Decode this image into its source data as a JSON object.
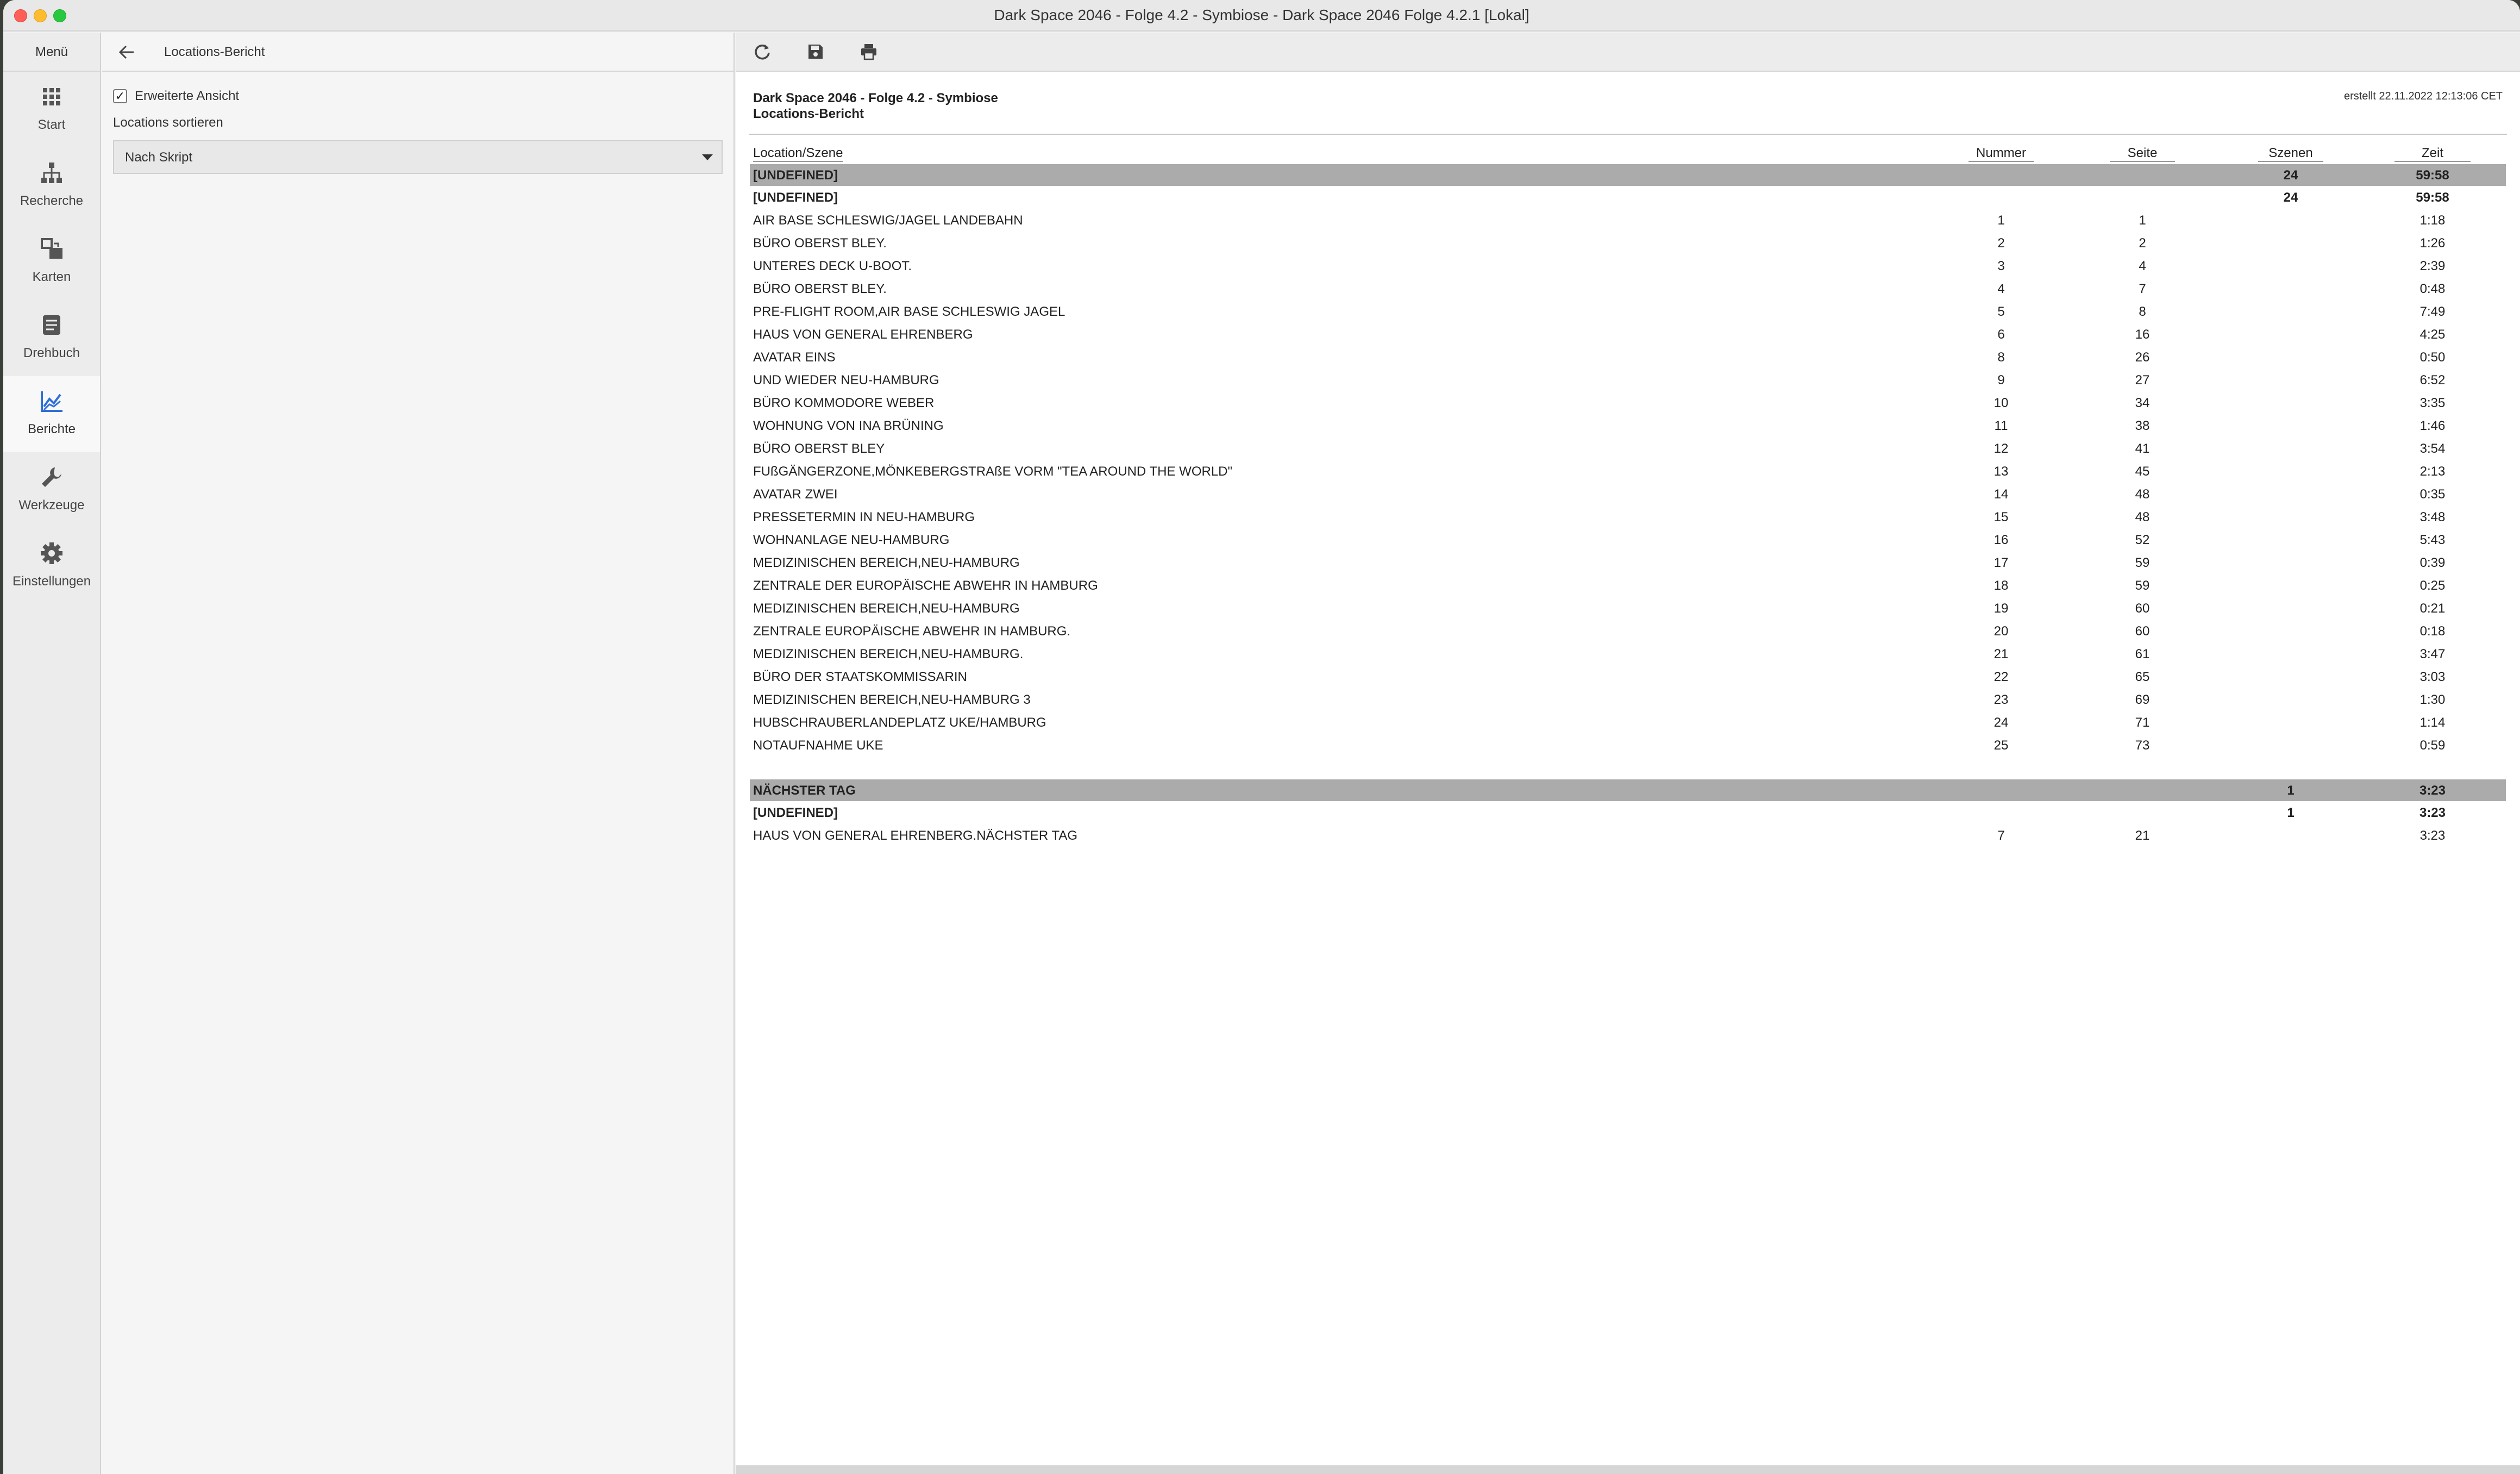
{
  "window": {
    "title": "Dark Space 2046 - Folge 4.2 - Symbiose - Dark Space 2046 Folge 4.2.1 [Lokal]"
  },
  "sidebar": {
    "menu_label": "Menü",
    "items": [
      {
        "label": "Start",
        "icon": "grid-icon"
      },
      {
        "label": "Recherche",
        "icon": "hierarchy-icon"
      },
      {
        "label": "Karten",
        "icon": "cards-icon"
      },
      {
        "label": "Drehbuch",
        "icon": "document-icon"
      },
      {
        "label": "Berichte",
        "icon": "chart-icon",
        "active": true
      },
      {
        "label": "Werkzeuge",
        "icon": "wrench-icon"
      },
      {
        "label": "Einstellungen",
        "icon": "gear-icon"
      }
    ]
  },
  "options": {
    "title": "Locations-Bericht",
    "extended_view_label": "Erweiterte Ansicht",
    "extended_view_checked": "✓",
    "sort_label": "Locations sortieren",
    "sort_value": "Nach Skript"
  },
  "report": {
    "title": "Dark Space 2046 - Folge 4.2 - Symbiose",
    "subtitle": "Locations-Bericht",
    "created": "erstellt 22.11.2022 12:13:06 CET",
    "columns": {
      "location": "Location/Szene",
      "number": "Nummer",
      "page": "Seite",
      "scenes": "Szenen",
      "time": "Zeit"
    },
    "groups": [
      {
        "name": "[UNDEFINED]",
        "scenes": "24",
        "time": "59:58",
        "sub": {
          "name": "[UNDEFINED]",
          "scenes": "24",
          "time": "59:58"
        },
        "rows": [
          {
            "loc": "AIR BASE SCHLESWIG/JAGEL LANDEBAHN",
            "num": "1",
            "page": "1",
            "time": "1:18"
          },
          {
            "loc": "BÜRO OBERST BLEY.",
            "num": "2",
            "page": "2",
            "time": "1:26"
          },
          {
            "loc": "UNTERES DECK U-BOOT.",
            "num": "3",
            "page": "4",
            "time": "2:39"
          },
          {
            "loc": "BÜRO OBERST BLEY.",
            "num": "4",
            "page": "7",
            "time": "0:48"
          },
          {
            "loc": "PRE-FLIGHT ROOM,AIR BASE SCHLESWIG JAGEL",
            "num": "5",
            "page": "8",
            "time": "7:49"
          },
          {
            "loc": "HAUS VON GENERAL EHRENBERG",
            "num": "6",
            "page": "16",
            "time": "4:25"
          },
          {
            "loc": "AVATAR EINS",
            "num": "8",
            "page": "26",
            "time": "0:50"
          },
          {
            "loc": "UND WIEDER NEU-HAMBURG",
            "num": "9",
            "page": "27",
            "time": "6:52"
          },
          {
            "loc": "BÜRO KOMMODORE WEBER",
            "num": "10",
            "page": "34",
            "time": "3:35"
          },
          {
            "loc": "WOHNUNG VON INA BRÜNING",
            "num": "11",
            "page": "38",
            "time": "1:46"
          },
          {
            "loc": "BÜRO OBERST BLEY",
            "num": "12",
            "page": "41",
            "time": "3:54"
          },
          {
            "loc": "FUßGÄNGERZONE,MÖNKEBERGSTRAßE VORM \"TEA AROUND THE WORLD\"",
            "num": "13",
            "page": "45",
            "time": "2:13"
          },
          {
            "loc": "AVATAR ZWEI",
            "num": "14",
            "page": "48",
            "time": "0:35"
          },
          {
            "loc": "PRESSETERMIN IN NEU-HAMBURG",
            "num": "15",
            "page": "48",
            "time": "3:48"
          },
          {
            "loc": "WOHNANLAGE NEU-HAMBURG",
            "num": "16",
            "page": "52",
            "time": "5:43"
          },
          {
            "loc": "MEDIZINISCHEN BEREICH,NEU-HAMBURG",
            "num": "17",
            "page": "59",
            "time": "0:39"
          },
          {
            "loc": "ZENTRALE DER EUROPÄISCHE ABWEHR IN HAMBURG",
            "num": "18",
            "page": "59",
            "time": "0:25"
          },
          {
            "loc": "MEDIZINISCHEN BEREICH,NEU-HAMBURG",
            "num": "19",
            "page": "60",
            "time": "0:21"
          },
          {
            "loc": "ZENTRALE EUROPÄISCHE ABWEHR IN HAMBURG.",
            "num": "20",
            "page": "60",
            "time": "0:18"
          },
          {
            "loc": "MEDIZINISCHEN BEREICH,NEU-HAMBURG.",
            "num": "21",
            "page": "61",
            "time": "3:47"
          },
          {
            "loc": "BÜRO DER STAATSKOMMISSARIN",
            "num": "22",
            "page": "65",
            "time": "3:03"
          },
          {
            "loc": "MEDIZINISCHEN BEREICH,NEU-HAMBURG 3",
            "num": "23",
            "page": "69",
            "time": "1:30"
          },
          {
            "loc": "HUBSCHRAUBERLANDEPLATZ UKE/HAMBURG",
            "num": "24",
            "page": "71",
            "time": "1:14"
          },
          {
            "loc": "NOTAUFNAHME UKE",
            "num": "25",
            "page": "73",
            "time": "0:59"
          }
        ]
      },
      {
        "name": "NÄCHSTER TAG",
        "scenes": "1",
        "time": "3:23",
        "sub": {
          "name": "[UNDEFINED]",
          "scenes": "1",
          "time": "3:23"
        },
        "rows": [
          {
            "loc": "HAUS VON GENERAL EHRENBERG.NÄCHSTER TAG",
            "num": "7",
            "page": "21",
            "time": "3:23"
          }
        ]
      }
    ]
  }
}
